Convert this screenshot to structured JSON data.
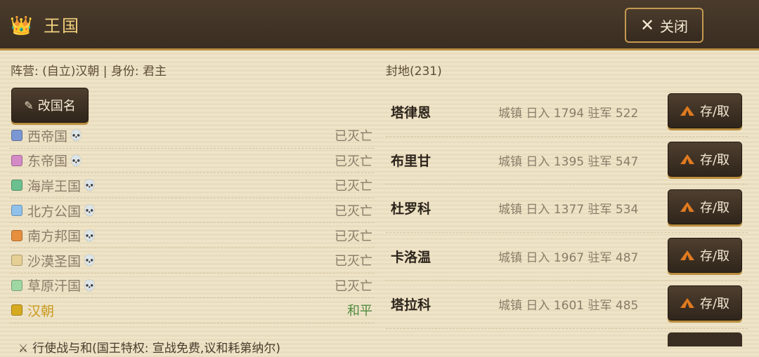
{
  "header": {
    "title": "王国",
    "icon": "crown-icon",
    "close_label": "关闭"
  },
  "faction": {
    "text": "阵营: (自立)汉朝 | 身份: 君主"
  },
  "rename_button": {
    "label": "改国名",
    "icon": "pencil-icon"
  },
  "kingdoms": [
    {
      "name": "西帝国",
      "status": "已灭亡",
      "color": "#7b97d3",
      "alive": false
    },
    {
      "name": "东帝国",
      "status": "已灭亡",
      "color": "#d48ac6",
      "alive": false
    },
    {
      "name": "海岸王国",
      "status": "已灭亡",
      "color": "#6cbf8e",
      "alive": false
    },
    {
      "name": "北方公国",
      "status": "已灭亡",
      "color": "#8fc1ea",
      "alive": false
    },
    {
      "name": "南方邦国",
      "status": "已灭亡",
      "color": "#e68f3e",
      "alive": false
    },
    {
      "name": "沙漠圣国",
      "status": "已灭亡",
      "color": "#e6cf94",
      "alive": false
    },
    {
      "name": "草原汗国",
      "status": "已灭亡",
      "color": "#9fd6a1",
      "alive": false
    },
    {
      "name": "汉朝",
      "status": "和平",
      "color": "#d6a91f",
      "alive": true
    }
  ],
  "war_power": {
    "text": "行使战与和(国王特权: 宣战免费,议和耗第纳尔)",
    "icon": "crossed-swords-icon"
  },
  "fiefs": {
    "header": "封地(231)",
    "items": [
      {
        "name": "塔律恩",
        "info": "城镇 日入 1794 驻军 522",
        "button": "存/取"
      },
      {
        "name": "布里甘",
        "info": "城镇 日入 1395 驻军 547",
        "button": "存/取"
      },
      {
        "name": "杜罗科",
        "info": "城镇 日入 1377 驻军 534",
        "button": "存/取"
      },
      {
        "name": "卡洛温",
        "info": "城镇 日入 1967 驻军 487",
        "button": "存/取"
      },
      {
        "name": "塔拉科",
        "info": "城镇 日入 1601 驻军 485",
        "button": "存/取"
      }
    ]
  }
}
